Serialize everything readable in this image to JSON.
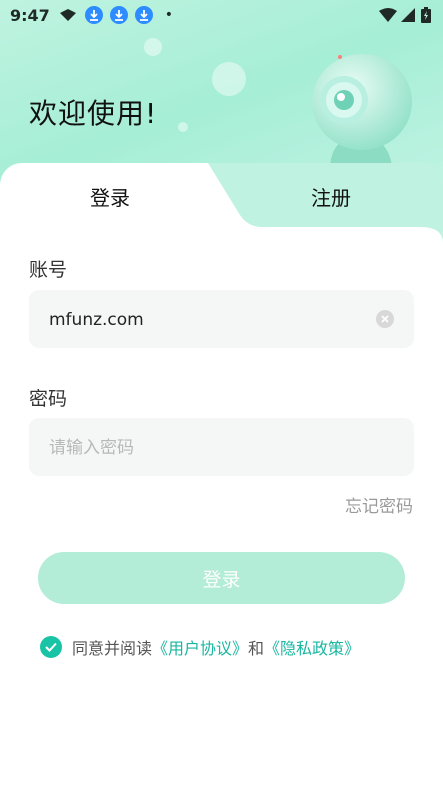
{
  "status_bar": {
    "time": "9:47",
    "dot": "•"
  },
  "header": {
    "welcome": "欢迎使用!"
  },
  "tabs": {
    "login": "登录",
    "register": "注册"
  },
  "account": {
    "label": "账号",
    "value": "mfunz.com"
  },
  "password": {
    "label": "密码",
    "placeholder": "请输入密码",
    "value": ""
  },
  "forgot_label": "忘记密码",
  "login_button_label": "登录",
  "agreement": {
    "prefix": "同意并阅读",
    "user_agreement": "《用户协议》",
    "and": "和",
    "privacy_policy": "《隐私政策》"
  },
  "colors": {
    "accent": "#19c3a6",
    "button_disabled": "#b3ecd7",
    "header_bg": "#a6eed6"
  },
  "icons": [
    "flag-icon",
    "download-icon",
    "wifi-icon",
    "signal-icon",
    "battery-icon",
    "clear-icon",
    "check-icon",
    "camera-icon"
  ]
}
